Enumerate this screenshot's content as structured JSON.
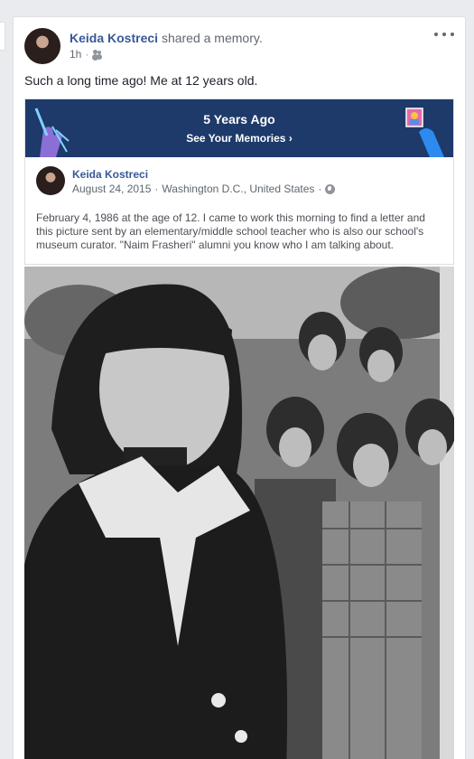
{
  "post": {
    "author": "Keida Kostreci",
    "action": "shared a memory.",
    "time": "1h",
    "audience_icon": "friends-icon",
    "more_icon": "more-horizontal-icon",
    "text": "Such a long time ago! Me at 12 years old."
  },
  "memory": {
    "banner_title": "5 Years Ago",
    "banner_link": "See Your Memories",
    "banner_link_chevron": "›",
    "author": "Keida Kostreci",
    "date": "August 24, 2015",
    "location": "Washington D.C., United States",
    "privacy_icon": "globe-icon",
    "body": "February 4, 1986 at the age of 12. I came to work this morning to find a letter and this picture sent by an elementary/middle school teacher who is also our school's museum curator. \"Naim Frasheri\" alumni you know who I am talking about."
  },
  "colors": {
    "banner": "#1d3a6a",
    "link": "#385898",
    "page_bg": "#e9ebee"
  }
}
